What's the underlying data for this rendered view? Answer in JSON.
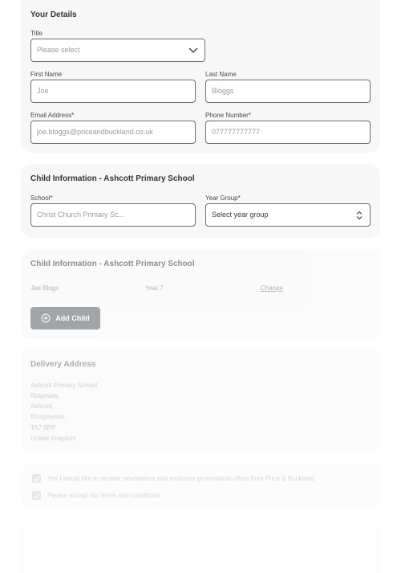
{
  "your_details": {
    "heading": "Your Details",
    "title_label": "Title",
    "title_placeholder": "Please select",
    "first_name_label": "First Name",
    "first_name_placeholder": "Joe",
    "last_name_label": "Last Name",
    "last_name_placeholder": "Bloggs",
    "email_label": "Email Address*",
    "email_placeholder": "joe.bloggs@priceandbuckland.co.uk",
    "phone_label": "Phone Number*",
    "phone_placeholder": "077777777777"
  },
  "child_form": {
    "heading": "Child Information - Ashcott Primary School",
    "school_label": "School*",
    "school_placeholder": "Christ Church Primary Sc...",
    "year_label": "Year Group*",
    "year_value": "Select year group"
  },
  "child_summary": {
    "heading": "Child Information - Ashcott Primary School",
    "child_name": "Joe Blogs",
    "child_year": "Year 7",
    "change_label": "Change",
    "add_child_label": "Add Child"
  },
  "delivery": {
    "heading": "Delivery Address",
    "lines": [
      "Ashcott Primary School,",
      "Ridgeway,",
      "Ashcott,",
      "Bridgewater,",
      "TA7 9PP",
      "United Kingdom"
    ]
  },
  "consents": {
    "newsletter": "Yes I would like to receive newsletters and exclusive promotional offers from Price & Buckland.",
    "terms": "Please accept our terms and conditions."
  },
  "colors": {
    "card_bg": "#f7f7f7",
    "button_bg": "#555c66",
    "border": "#6e6e6e"
  }
}
